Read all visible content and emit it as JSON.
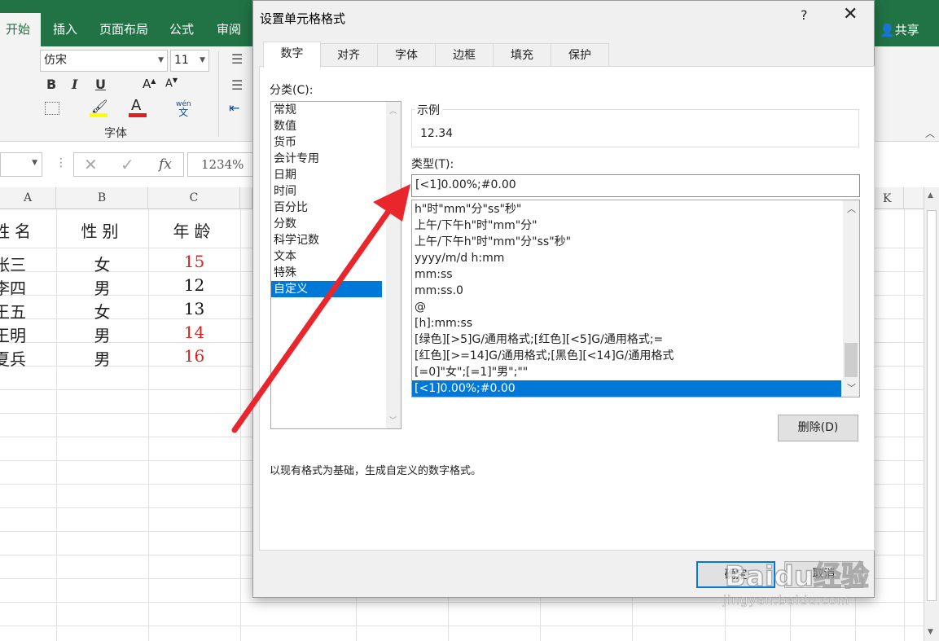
{
  "ribbon": {
    "tabs": [
      "开始",
      "插入",
      "页面布局",
      "公式",
      "审阅"
    ],
    "share": "共享",
    "font_name": "仿宋",
    "font_size": "11",
    "bold": "B",
    "italic": "I",
    "underline": "U",
    "font_group_label": "字体",
    "wen_label": "wén\n文"
  },
  "formula_bar": {
    "name_box": "",
    "fx": "fx",
    "value": "1234%"
  },
  "sheet": {
    "columns": [
      "A",
      "B",
      "C",
      "K"
    ],
    "header": [
      "姓名",
      "性别",
      "年龄"
    ],
    "rows": [
      {
        "name": "张三",
        "gender": "女",
        "age": "15",
        "age_color": "#e0201f"
      },
      {
        "name": "李四",
        "gender": "男",
        "age": "12",
        "age_color": "#111111"
      },
      {
        "name": "王五",
        "gender": "女",
        "age": "13",
        "age_color": "#111111"
      },
      {
        "name": "王明",
        "gender": "男",
        "age": "14",
        "age_color": "#e0201f"
      },
      {
        "name": "夏兵",
        "gender": "男",
        "age": "16",
        "age_color": "#e0201f"
      }
    ]
  },
  "dialog": {
    "title": "设置单元格格式",
    "help": "?",
    "close": "✕",
    "tabs": [
      "数字",
      "对齐",
      "字体",
      "边框",
      "填充",
      "保护"
    ],
    "category_label": "分类(C):",
    "categories": [
      "常规",
      "数值",
      "货币",
      "会计专用",
      "日期",
      "时间",
      "百分比",
      "分数",
      "科学记数",
      "文本",
      "特殊",
      "自定义"
    ],
    "selected_category": "自定义",
    "sample_label": "示例",
    "sample_value": "12.34",
    "type_label": "类型(T):",
    "type_value": "[<1]0.00%;#0.00",
    "formats": [
      "h\"时\"mm\"分\"ss\"秒\"",
      "上午/下午h\"时\"mm\"分\"",
      "上午/下午h\"时\"mm\"分\"ss\"秒\"",
      "yyyy/m/d h:mm",
      "mm:ss",
      "mm:ss.0",
      "@",
      "[h]:mm:ss",
      "[绿色][>5]G/通用格式;[红色][<5]G/通用格式;=",
      "[红色][>=14]G/通用格式;[黑色][<14]G/通用格式",
      "[=0]\"女\";[=1]\"男\";\"\"",
      "[<1]0.00%;#0.00"
    ],
    "delete_button": "删除(D)",
    "description": "以现有格式为基础，生成自定义的数字格式。",
    "ok_button": "确定",
    "cancel_button": "取消"
  },
  "colors": {
    "excel_green": "#217346",
    "selection_blue": "#0078d7",
    "arrow_red": "#e8262b"
  },
  "watermark": {
    "brand": "Baidu经验",
    "url": "jingyan.baidu.com"
  }
}
